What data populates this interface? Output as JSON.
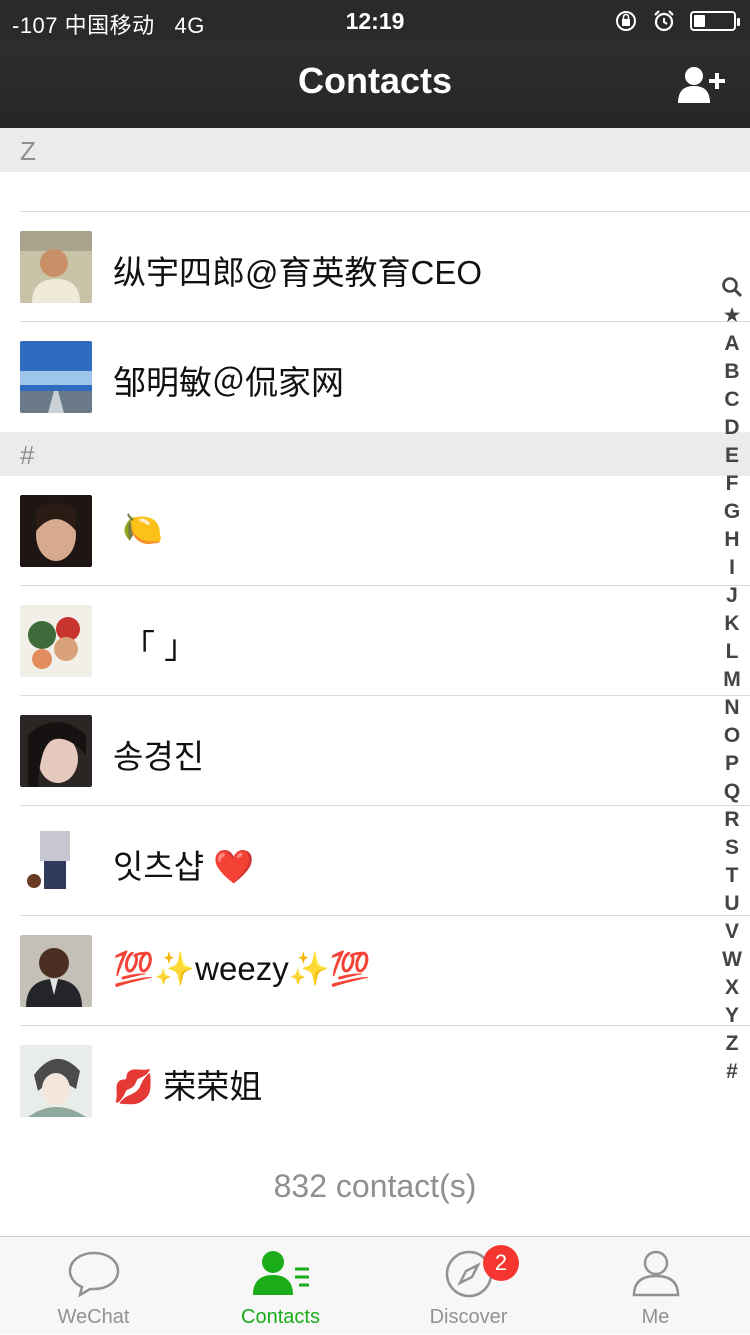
{
  "status": {
    "signal": "-107",
    "carrier": "中国移动",
    "network": "4G",
    "time": "12:19",
    "battery_level": 0.3
  },
  "nav": {
    "title": "Contacts",
    "add_icon": "add-contact-icon"
  },
  "sections": [
    {
      "letter": "Z"
    },
    {
      "letter": "#"
    }
  ],
  "contacts": [
    {
      "name": "纵宇四郎@育英教育CEO"
    },
    {
      "name": "邹明敏＠侃家网"
    },
    {
      "name": "🍋"
    },
    {
      "name": "「                     」"
    },
    {
      "name": "송경진"
    },
    {
      "name": "잇츠샵 ❤️"
    },
    {
      "name": "💯✨weezy✨💯"
    },
    {
      "name": "💋 荣荣姐"
    }
  ],
  "footer": {
    "count": "832 contact(s)"
  },
  "index_letters": [
    "★",
    "A",
    "B",
    "C",
    "D",
    "E",
    "F",
    "G",
    "H",
    "I",
    "J",
    "K",
    "L",
    "M",
    "N",
    "O",
    "P",
    "Q",
    "R",
    "S",
    "T",
    "U",
    "V",
    "W",
    "X",
    "Y",
    "Z",
    "#"
  ],
  "tabs": [
    {
      "label": "WeChat",
      "icon": "chat-bubble-icon"
    },
    {
      "label": "Contacts",
      "icon": "contacts-icon"
    },
    {
      "label": "Discover",
      "icon": "compass-icon",
      "badge": "2"
    },
    {
      "label": "Me",
      "icon": "person-icon"
    }
  ],
  "colors": {
    "accent": "#1aad19",
    "badge": "#f43530",
    "navbar": "#2a2a2c"
  }
}
